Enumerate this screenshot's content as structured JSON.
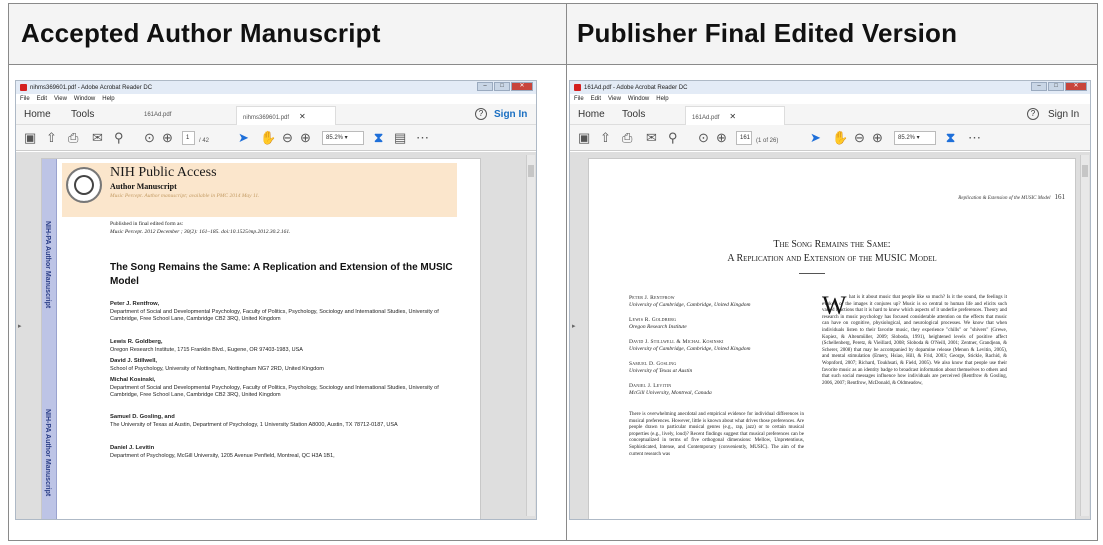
{
  "headers": {
    "left": "Accepted Author Manuscript",
    "right": "Publisher Final Edited Version"
  },
  "left_window": {
    "title": "nihms369601.pdf - Adobe Acrobat Reader DC",
    "menu": [
      "File",
      "Edit",
      "View",
      "Window",
      "Help"
    ],
    "nav": {
      "home": "Home",
      "tools": "Tools"
    },
    "tabs": [
      "161Ad.pdf",
      "nihms369601.pdf"
    ],
    "help": "?",
    "signin": "Sign In",
    "page_number": "1",
    "page_total": "/ 42",
    "zoom": "85.2%",
    "sidebar_text": [
      "NIH-PA Author Manuscript",
      "NIH-PA Author Manuscript"
    ],
    "nih_title": "NIH Public Access",
    "nih_subtitle": "Author Manuscript",
    "nih_meta": "Music Percept. Author manuscript; available in PMC 2014 May 11.",
    "pub_line1": "Published in final edited form as:",
    "pub_line2": "Music Percept. 2012 December ; 30(2): 161–185. doi:10.1525/mp.2012.30.2.161.",
    "article_title": "The Song Remains the Same: A Replication and Extension of the MUSIC Model",
    "authors": [
      {
        "name": "Peter J. Rentfrow,",
        "affil": "Department of Social and Developmental Psychology, Faculty of Politics, Psychology, Sociology and International Studies, University of Cambridge, Free School Lane, Cambridge CB2 3RQ, United Kingdom"
      },
      {
        "name": "Lewis R. Goldberg,",
        "affil": "Oregon Research Institute, 1715 Franklin Blvd., Eugene, OR 97403-1983, USA"
      },
      {
        "name": "David J. Stillwell,",
        "affil": "School of Psychology, University of Nottingham, Nottingham NG7 2RD, United Kingdom"
      },
      {
        "name": "Michal Kosinski,",
        "affil": "Department of Social and Developmental Psychology, Faculty of Politics, Psychology, Sociology and International Studies, University of Cambridge, Free School Lane, Cambridge CB2 3RQ, United Kingdom"
      },
      {
        "name": "Samuel D. Gosling, and",
        "affil": "The University of Texas at Austin, Department of Psychology, 1 University Station A8000, Austin, TX 78712-0187, USA"
      },
      {
        "name": "Daniel J. Levitin",
        "affil": "Department of Psychology, McGill University, 1205 Avenue Penfield, Montreal, QC H3A 1B1,"
      }
    ]
  },
  "right_window": {
    "title": "161Ad.pdf - Adobe Acrobat Reader DC",
    "menu": [
      "File",
      "Edit",
      "View",
      "Window",
      "Help"
    ],
    "nav": {
      "home": "Home",
      "tools": "Tools"
    },
    "tabs": [
      "161Ad.pdf"
    ],
    "help": "?",
    "signin": "Sign In",
    "page_number": "161",
    "page_total": "(1 of 26)",
    "zoom": "85.2%",
    "running_head": "Replication & Extension of the MUSIC Model",
    "page_num": "161",
    "title_line1": "The Song Remains the Same:",
    "title_line2": "A Replication and Extension of the MUSIC Model",
    "authors": [
      {
        "name": "Peter J. Rentfrow",
        "affil": "University of Cambridge, Cambridge, United Kingdom"
      },
      {
        "name": "Lewis R. Goldberg",
        "affil": "Oregon Research Institute"
      },
      {
        "name": "David J. Stillwell & Michal Kosinski",
        "affil": "University of Cambridge, Cambridge, United Kingdom"
      },
      {
        "name": "Samuel D. Gosling",
        "affil": "University of Texas at Austin"
      },
      {
        "name": "Daniel J. Levitin",
        "affil": "McGill University, Montreal, Canada"
      }
    ],
    "abstract": "There is overwhelming anecdotal and empirical evidence for individual differences in musical preferences. However, little is known about what drives those preferences. Are people drawn to particular musical genres (e.g., rap, jazz) or to certain musical properties (e.g., lively, loud)? Recent findings suggest that musical preferences can be conceptualized in terms of five orthogonal dimensions: Mellow, Unpretentious, Sophisticated, Intense, and Contemporary (conveniently, MUSIC). The aim of the current research was",
    "drop_cap": "W",
    "body": "hat is it about music that people like so much? Is it the sound, the feelings it evokes, or the images it conjures up? Music is so central to human life and elicits such varied reactions that it is hard to know which aspects of it underlie preferences. Theory and research in music psychology has focused considerable attention on the effects that music can have on cognitive, physiological, and neurological processes. We know that when individuals listen to their favorite music, they experience \"chills\" or \"shivers\" (Grewe, Kopiez, & Altenmüller, 2009; Sloboda, 1991), heightened levels of positive affect (Schellenberg, Peretz, & Vieillard, 2008; Sloboda & O'Neill, 2001; Zentner, Grandjean, & Scherer, 2008) that may be accompanied by dopamine release (Menon & Levitin, 2005), and mental stimulation (Emery, Hsiao, Hill, & Frid, 2003; George, Stickle, Rachid, & Wopnford, 2007; Richard, Toukhsati, & Field, 2005). We also know that people use their favorite music as an identity badge to broadcast information about themselves to others and that such social messages influence how individuals are perceived (Rentfrow & Gosling, 2006, 2007; Rentfrow, McDonald, & Oldmeadow,"
  }
}
